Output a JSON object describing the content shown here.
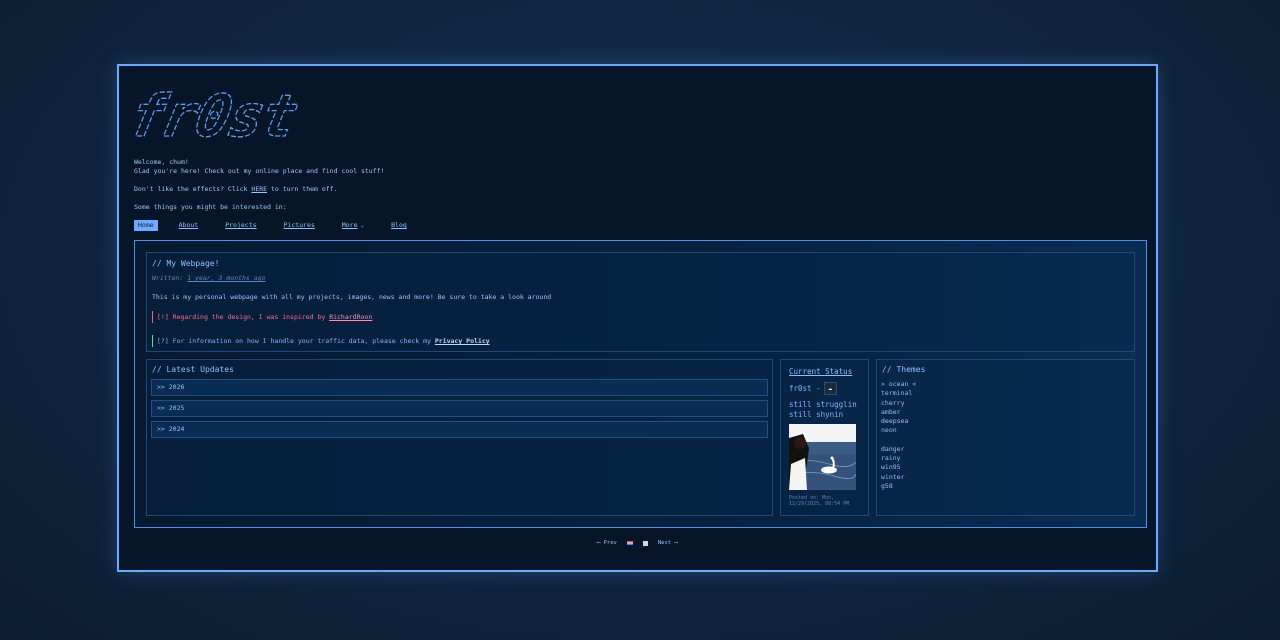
{
  "site": {
    "logo_text": "fr0st"
  },
  "intro": {
    "welcome": "Welcome, chum!",
    "glad": "Glad you're here! Check out my online place and find cool stuff!",
    "effects_before": "Don't like the effects? Click ",
    "effects_link": "HERE",
    "effects_after": " to turn them off.",
    "interest": "Some things you might be interested in:"
  },
  "nav": {
    "home": "Home",
    "about": "About",
    "projects": "Projects",
    "pictures": "Pictures",
    "more": "More",
    "more_caret": "⌄",
    "blog": "Blog"
  },
  "welcome_box": {
    "title": "// My Webpage!",
    "written_label": "Written: ",
    "written_value": "1 year, 3 months ago",
    "description": "This is my personal webpage with all my projects, images, news and more! Be sure to take a look around",
    "warn_prefix": "[!] Regarding the design, I was inspired by ",
    "warn_link": "RichardRoon",
    "info_prefix": "[?] For information on how I handle your traffic data, please check my ",
    "info_link": "Privacy Policy"
  },
  "updates": {
    "title": "// Latest Updates",
    "rows": [
      ">> 2026",
      ">> 2025",
      ">> 2024"
    ]
  },
  "status": {
    "title": "Current Status",
    "who": "fr0st -",
    "line1": "still strugglin",
    "line2": "still shynin",
    "posted": "Posted on: Mon, 12/29/2025, 08:54 PM"
  },
  "themes": {
    "title": "// Themes",
    "group1": [
      "> ocean <",
      "terminal",
      "cherry",
      "amber",
      "deepsea",
      "neon"
    ],
    "group2": [
      "danger",
      "rainy",
      "win95",
      "winter",
      "g58"
    ]
  },
  "pager": {
    "prev": "⟵ Prev",
    "next": "Next ⟶"
  },
  "colors": {
    "accent": "#6fa8ff",
    "warn": "#ff6b85",
    "info_border": "#4fe0a0"
  }
}
